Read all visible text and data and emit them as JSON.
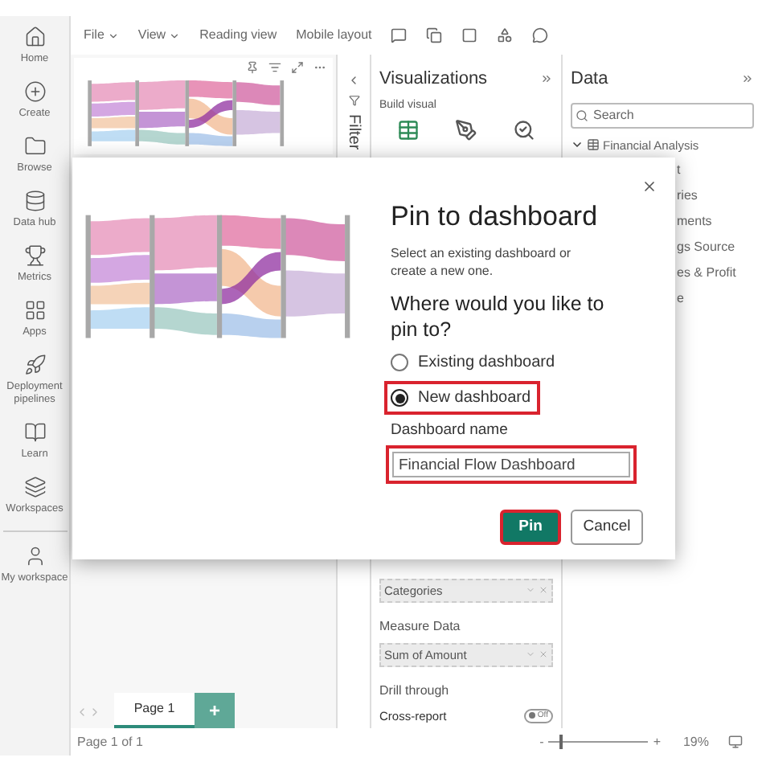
{
  "toolbar": {
    "menus": [
      {
        "label": "File",
        "dropdown": true
      },
      {
        "label": "View",
        "dropdown": true
      },
      {
        "label": "Reading view",
        "dropdown": false
      },
      {
        "label": "Mobile layout",
        "dropdown": false
      }
    ]
  },
  "nav": [
    {
      "label": "Home"
    },
    {
      "label": "Create"
    },
    {
      "label": "Browse"
    },
    {
      "label": "Data hub"
    },
    {
      "label": "Metrics"
    },
    {
      "label": "Apps"
    },
    {
      "label": "Deployment pipelines"
    },
    {
      "label": "Learn"
    },
    {
      "label": "Workspaces"
    },
    {
      "label": "My workspace"
    }
  ],
  "filters": {
    "label": "Filter"
  },
  "visualizations": {
    "title": "Visualizations",
    "subtitle": "Build visual",
    "wells": [
      {
        "kind": "field",
        "label": "Categories"
      },
      {
        "kind": "heading",
        "label": "Measure Data"
      },
      {
        "kind": "field",
        "label": "Sum of Amount"
      },
      {
        "kind": "heading",
        "label": "Drill through"
      },
      {
        "kind": "toggle",
        "label": "Cross-report",
        "on": false,
        "state_label": "Off"
      }
    ]
  },
  "data": {
    "title": "Data",
    "search": {
      "placeholder": "Search"
    },
    "tree": {
      "label": "Financial Analysis",
      "expanded": true,
      "children": [
        {
          "label": "t"
        },
        {
          "label": "ries"
        },
        {
          "label": "ments"
        },
        {
          "label": "gs Source"
        },
        {
          "label": "es & Profit"
        },
        {
          "label": "e"
        }
      ]
    }
  },
  "page_tabs": [
    {
      "label": "Page 1",
      "selected": true
    }
  ],
  "add_page": "+",
  "status_bar": {
    "page": "Page 1 of 1",
    "zoom_out": "-",
    "zoom_in": "+",
    "zoom": {
      "level": 0.1
    },
    "zoom_percent": "19%"
  },
  "dialog": {
    "title": "Pin to dashboard",
    "description": "Select an existing dashboard or create a new one.",
    "question": "Where would you like to pin to?",
    "options": [
      {
        "label": "Existing dashboard",
        "selected": false,
        "highlighted": false
      },
      {
        "label": "New dashboard",
        "selected": true,
        "highlighted": true
      }
    ],
    "name_field": {
      "label": "Dashboard name",
      "value": "Financial Flow Dashboard",
      "highlighted": true
    },
    "buttons": [
      {
        "label": "Pin",
        "kind": "primary",
        "highlighted": true
      },
      {
        "label": "Cancel",
        "kind": "secondary",
        "highlighted": false
      }
    ]
  }
}
